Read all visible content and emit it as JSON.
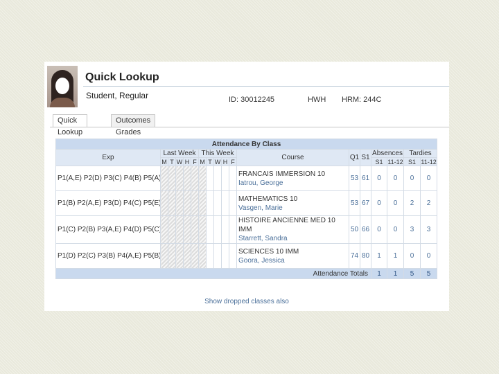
{
  "page": {
    "title": "Quick Lookup"
  },
  "student": {
    "name": "Student, Regular",
    "id": "ID: 30012245",
    "field2": "HWH",
    "homeroom": "HRM: 244C"
  },
  "tabs": [
    {
      "label": "Quick Lookup",
      "active": true
    },
    {
      "label": "Outcomes Grades",
      "active": false
    }
  ],
  "table": {
    "title": "Attendance By Class",
    "headers": {
      "exp": "Exp",
      "last_week": "Last Week",
      "this_week": "This Week",
      "course": "Course",
      "q1": "Q1",
      "s1": "S1",
      "absences": "Absences",
      "tardies": "Tardies"
    },
    "day_letters": [
      "M",
      "T",
      "W",
      "H",
      "F",
      "M",
      "T",
      "W",
      "H",
      "F"
    ],
    "abs_sub": [
      "S1",
      "11-12"
    ],
    "tar_sub": [
      "S1",
      "11-12"
    ],
    "rows": [
      {
        "exp": "P1(A,E) P2(D) P3(C) P4(B) P5(A)",
        "course": "FRANCAIS IMMERSION 10",
        "teacher": "Iatrou, George",
        "q1": "53",
        "s1": "61",
        "abs_s1": "0",
        "abs_year": "0",
        "tar_s1": "0",
        "tar_year": "0"
      },
      {
        "exp": "P1(B) P2(A,E) P3(D) P4(C) P5(E)",
        "course": "MATHEMATICS 10",
        "teacher": "Vasgen, Marie",
        "q1": "53",
        "s1": "67",
        "abs_s1": "0",
        "abs_year": "0",
        "tar_s1": "2",
        "tar_year": "2"
      },
      {
        "exp": "P1(C) P2(B) P3(A,E) P4(D) P5(C)",
        "course": "HISTOIRE ANCIENNE MED 10 IMM",
        "teacher": "Starrett, Sandra",
        "q1": "50",
        "s1": "66",
        "abs_s1": "0",
        "abs_year": "0",
        "tar_s1": "3",
        "tar_year": "3"
      },
      {
        "exp": "P1(D) P2(C) P3(B) P4(A,E) P5(B)",
        "course": "SCIENCES 10 IMM",
        "teacher": "Goora, Jessica",
        "q1": "74",
        "s1": "80",
        "abs_s1": "1",
        "abs_year": "1",
        "tar_s1": "0",
        "tar_year": "0"
      }
    ],
    "totals": {
      "label": "Attendance Totals",
      "abs_s1": "1",
      "abs_year": "1",
      "tar_s1": "5",
      "tar_year": "5"
    }
  },
  "links": {
    "show_dropped": "Show dropped classes also"
  }
}
